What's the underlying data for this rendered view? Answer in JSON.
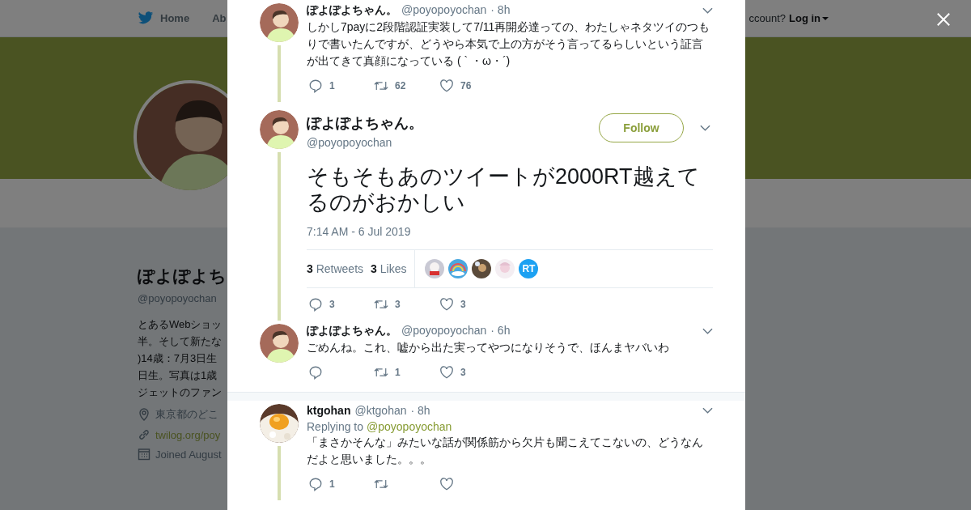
{
  "background": {
    "nav": {
      "home": "Home",
      "about": "Ab",
      "account_prompt": "ccount?",
      "login": "Log in"
    },
    "profile": {
      "name": "ぽよぽよち",
      "handle": "@poyopoyochan",
      "bio": [
        "とあるWebショッ",
        "半。そして新たな",
        ")14歳：7月3日生",
        "日生。写真は1歳",
        "ジェットのファン"
      ],
      "location": "東京都のどこ",
      "website": "twilog.org/poy",
      "joined": "Joined August"
    }
  },
  "tweets": [
    {
      "kind": "thread",
      "name": "ぽよぽよちゃん。",
      "handle": "@poyopoyochan",
      "time": "· 8h",
      "avatar": {
        "kind": "person"
      },
      "connected_below": true,
      "text": "しかし7payに2段階認証実装して7/11再開必達っての、わたしゃネタツイのつもりで書いたんですが、どうやら本気で上の方がそう言ってるらしいという証言が出てきて真顔になっている ( ` ・ω・´)",
      "actions": {
        "reply": "1",
        "retweet": "62",
        "like": "76"
      }
    },
    {
      "kind": "focused",
      "name": "ぽよぽよちゃん。",
      "handle": "@poyopoyochan",
      "avatar": {
        "kind": "person"
      },
      "connected_below": true,
      "follow": "Follow",
      "text": "そもそもあのツイートが2000RT越えてるのがおかしい",
      "timestamp": "7:14 AM - 6 Jul 2019",
      "stats": [
        {
          "count": "3",
          "label": "Retweets"
        },
        {
          "count": "3",
          "label": "Likes"
        }
      ],
      "likers": [
        {
          "kind": "picture"
        },
        {
          "kind": "picture"
        },
        {
          "kind": "picture"
        },
        {
          "kind": "picture"
        },
        {
          "kind": "badge",
          "label": "RT"
        }
      ],
      "actions": {
        "reply": "3",
        "retweet": "3",
        "like": "3"
      }
    },
    {
      "kind": "thread",
      "name": "ぽよぽよちゃん。",
      "handle": "@poyopoyochan",
      "time": "· 6h",
      "avatar": {
        "kind": "person"
      },
      "connected_below": false,
      "text": "ごめんね。これ、嘘から出た実ってやつになりそうで、ほんまヤバいわ",
      "actions": {
        "retweet": "1",
        "like": "3"
      }
    },
    {
      "kind": "separator"
    },
    {
      "kind": "thread",
      "name": "ktgohan",
      "handle": "@ktgohan",
      "time": "· 8h",
      "avatar": {
        "kind": "picture"
      },
      "connected_below": true,
      "replying_label": "Replying to",
      "replying_to": "@poyopoyochan",
      "text": "「まさかそんな」みたいな話が関係筋から欠片も聞こえてこないの、どうなんだよと思いました。。。",
      "actions": {
        "reply": "1"
      }
    }
  ]
}
